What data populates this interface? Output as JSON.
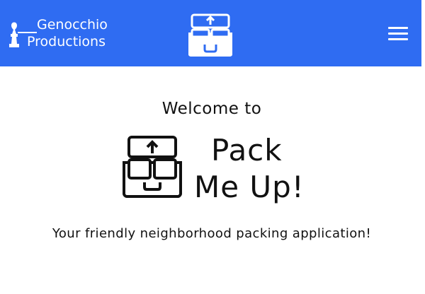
{
  "header": {
    "brand_line1": "Genocchio",
    "brand_line2": "Productions",
    "background_color": "#2f6cf2",
    "logo_icon": "box-upload-icon",
    "menu_icon": "hamburger-menu-icon"
  },
  "hero": {
    "welcome": "Welcome to",
    "title_line1": "Pack",
    "title_line2": "Me Up!",
    "logo_icon": "box-upload-icon",
    "tagline": "Your friendly neighborhood packing application!"
  }
}
